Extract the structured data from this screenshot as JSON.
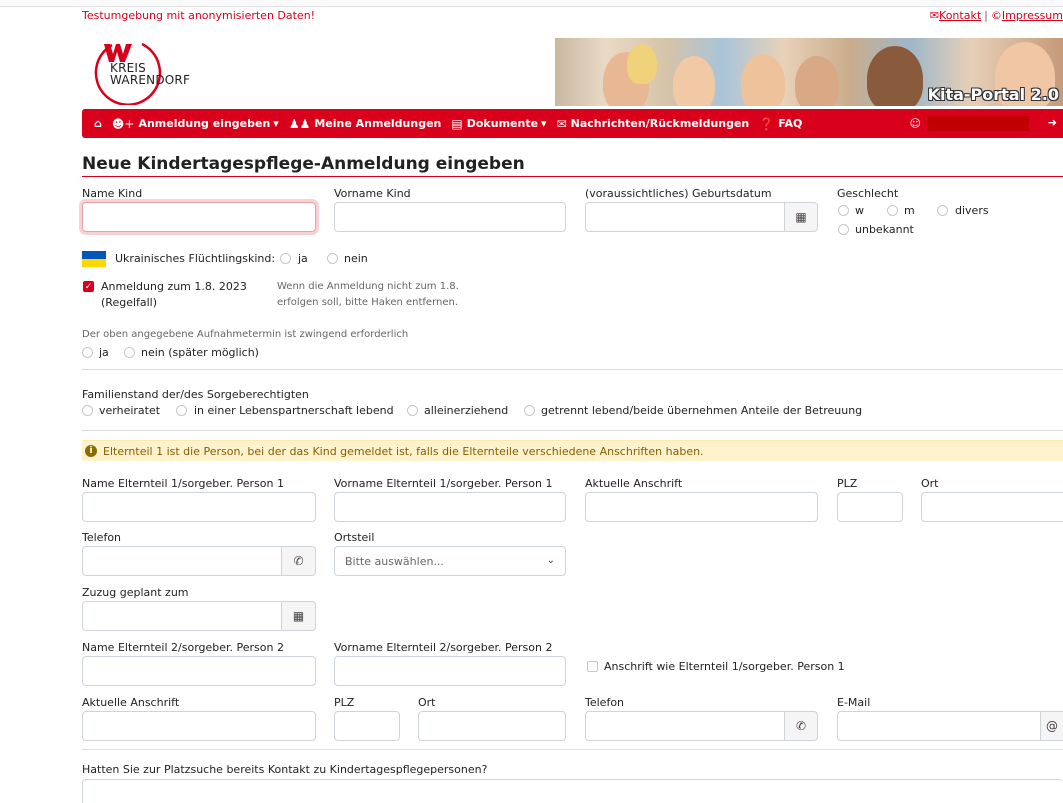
{
  "header": {
    "test_notice": "Testumgebung mit anonymisierten Daten!",
    "contact_link": "Kontakt",
    "separator": "|",
    "imprint_link": "Impressum",
    "logo_line1": "KREIS",
    "logo_line2": "WARENDORF",
    "banner_title": "Kita-Portal 2.0"
  },
  "nav": {
    "home_icon": "home-icon",
    "items": [
      {
        "label": "Anmeldung eingeben",
        "icon": "user-plus-icon",
        "dropdown": true
      },
      {
        "label": "Meine Anmeldungen",
        "icon": "users-icon",
        "dropdown": false
      },
      {
        "label": "Dokumente",
        "icon": "document-icon",
        "dropdown": true
      },
      {
        "label": "Nachrichten/Rückmeldungen",
        "icon": "envelope-icon",
        "dropdown": false
      },
      {
        "label": "FAQ",
        "icon": "faq-icon",
        "dropdown": false
      }
    ],
    "dropdown_caret": "▾"
  },
  "page": {
    "title": "Neue Kindertagespflege-Anmeldung eingeben"
  },
  "child": {
    "name_label": "Name Kind",
    "name_value": "",
    "firstname_label": "Vorname Kind",
    "firstname_value": "",
    "birthdate_label": "(voraussichtliches) Geburtsdatum",
    "birthdate_value": "",
    "gender_label": "Geschlecht",
    "gender_options": [
      "w",
      "m",
      "divers",
      "unbekannt"
    ]
  },
  "refugee": {
    "label": "Ukrainisches Flüchtlingskind:",
    "options": [
      "ja",
      "nein"
    ]
  },
  "registration": {
    "checkbox_line1": "Anmeldung zum 1.8. 2023",
    "checkbox_line2": "(Regelfall)",
    "checked": true,
    "hint_line1": "Wenn die Anmeldung nicht zum 1.8.",
    "hint_line2": "erfolgen soll, bitte Haken entfernen."
  },
  "mandatory_date": {
    "label": "Der oben angegebene Aufnahmetermin ist zwingend erforderlich",
    "options": [
      "ja",
      "nein (später möglich)"
    ]
  },
  "family": {
    "label": "Familienstand der/des Sorgeberechtigten",
    "options": [
      "verheiratet",
      "in einer Lebenspartnerschaft lebend",
      "alleinerziehend",
      "getrennt lebend/beide übernehmen Anteile der Betreuung"
    ]
  },
  "alert": {
    "icon": "info-icon",
    "text": "Elternteil 1 ist die Person, bei der das Kind gemeldet ist, falls die Elternteile verschiedene Anschriften haben."
  },
  "parent1": {
    "name_label": "Name Elternteil 1/sorgeber. Person 1",
    "firstname_label": "Vorname Elternteil 1/sorgeber. Person 1",
    "address_label": "Aktuelle Anschrift",
    "zip_label": "PLZ",
    "city_label": "Ort",
    "phone_label": "Telefon",
    "district_label": "Ortsteil",
    "district_placeholder": "Bitte auswählen...",
    "move_label": "Zuzug geplant zum"
  },
  "parent2": {
    "name_label": "Name Elternteil 2/sorgeber. Person 2",
    "firstname_label": "Vorname Elternteil 2/sorgeber. Person 2",
    "same_address_label": "Anschrift wie Elternteil 1/sorgeber. Person 1",
    "address_label": "Aktuelle Anschrift",
    "zip_label": "PLZ",
    "city_label": "Ort",
    "phone_label": "Telefon",
    "email_label": "E-Mail"
  },
  "contact_question": {
    "label": "Hatten Sie zur Platzsuche bereits Kontakt zu Kindertagespflegepersonen?"
  },
  "colors": {
    "brand_red": "#d9001b",
    "alert_bg": "#fff3cd"
  }
}
